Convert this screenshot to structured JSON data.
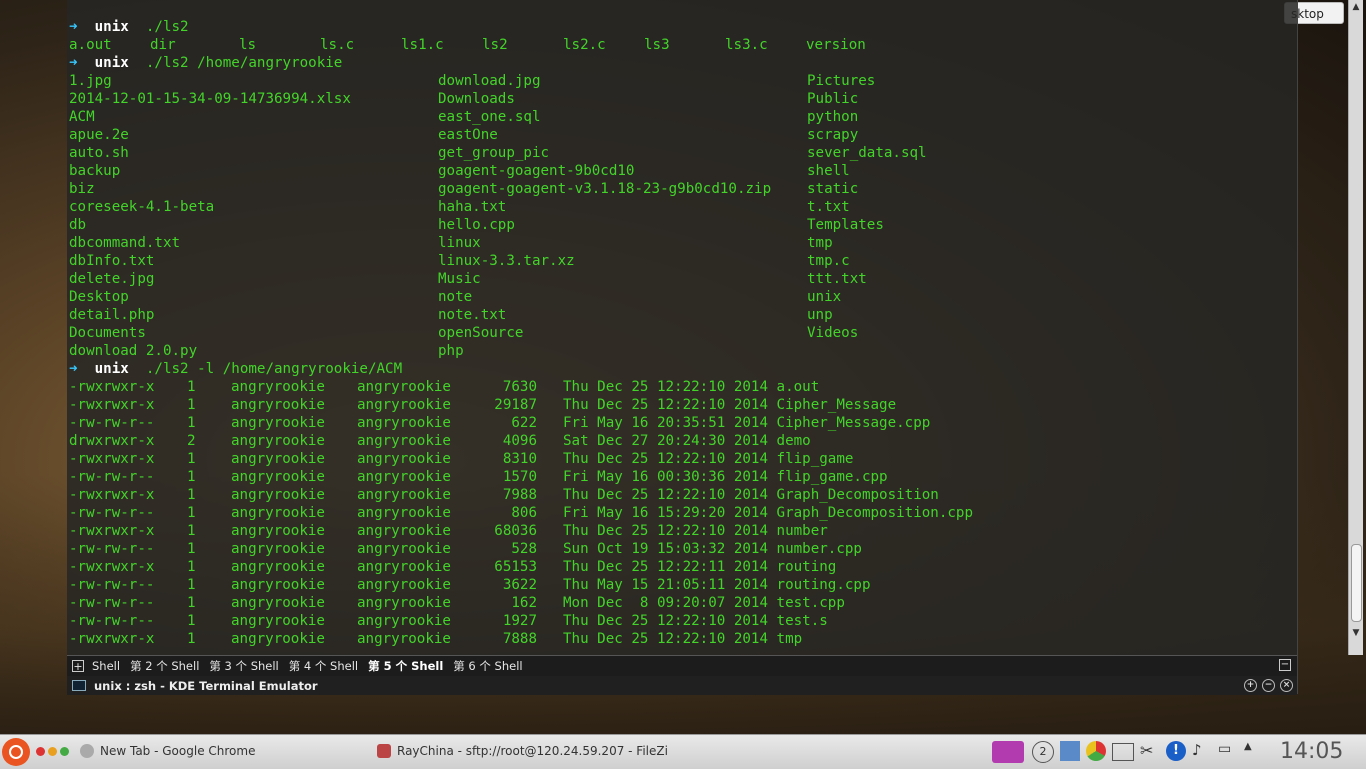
{
  "desktop": {
    "corner_label": "sktop"
  },
  "terminal": {
    "prompt_host": "unix",
    "cmd1": "./ls2",
    "cmd1_output": [
      "a.out",
      "dir",
      "ls",
      "ls.c",
      "ls1.c",
      "ls2",
      "ls2.c",
      "ls3",
      "ls3.c",
      "version"
    ],
    "cmd2": "./ls2 /home/angryrookie",
    "listing": [
      [
        "1.jpg",
        "download.jpg",
        "Pictures"
      ],
      [
        "2014-12-01-15-34-09-14736994.xlsx",
        "Downloads",
        "Public"
      ],
      [
        "ACM",
        "east_one.sql",
        "python"
      ],
      [
        "apue.2e",
        "eastOne",
        "scrapy"
      ],
      [
        "auto.sh",
        "get_group_pic",
        "sever_data.sql"
      ],
      [
        "backup",
        "goagent-goagent-9b0cd10",
        "shell"
      ],
      [
        "biz",
        "goagent-goagent-v3.1.18-23-g9b0cd10.zip",
        "static"
      ],
      [
        "coreseek-4.1-beta",
        "haha.txt",
        "t.txt"
      ],
      [
        "db",
        "hello.cpp",
        "Templates"
      ],
      [
        "dbcommand.txt",
        "linux",
        "tmp"
      ],
      [
        "dbInfo.txt",
        "linux-3.3.tar.xz",
        "tmp.c"
      ],
      [
        "delete.jpg",
        "Music",
        "ttt.txt"
      ],
      [
        "Desktop",
        "note",
        "unix"
      ],
      [
        "detail.php",
        "note.txt",
        "unp"
      ],
      [
        "Documents",
        "openSource",
        "Videos"
      ],
      [
        "download 2.0.py",
        "php",
        ""
      ]
    ],
    "cmd3": "./ls2 -l /home/angryrookie/ACM",
    "long_listing": [
      [
        "-rwxrwxr-x",
        "1",
        "angryrookie",
        "angryrookie",
        "7630",
        "Thu Dec 25 12:22:10 2014",
        "a.out"
      ],
      [
        "-rwxrwxr-x",
        "1",
        "angryrookie",
        "angryrookie",
        "29187",
        "Thu Dec 25 12:22:10 2014",
        "Cipher_Message"
      ],
      [
        "-rw-rw-r--",
        "1",
        "angryrookie",
        "angryrookie",
        "622",
        "Fri May 16 20:35:51 2014",
        "Cipher_Message.cpp"
      ],
      [
        "drwxrwxr-x",
        "2",
        "angryrookie",
        "angryrookie",
        "4096",
        "Sat Dec 27 20:24:30 2014",
        "demo"
      ],
      [
        "-rwxrwxr-x",
        "1",
        "angryrookie",
        "angryrookie",
        "8310",
        "Thu Dec 25 12:22:10 2014",
        "flip_game"
      ],
      [
        "-rw-rw-r--",
        "1",
        "angryrookie",
        "angryrookie",
        "1570",
        "Fri May 16 00:30:36 2014",
        "flip_game.cpp"
      ],
      [
        "-rwxrwxr-x",
        "1",
        "angryrookie",
        "angryrookie",
        "7988",
        "Thu Dec 25 12:22:10 2014",
        "Graph_Decomposition"
      ],
      [
        "-rw-rw-r--",
        "1",
        "angryrookie",
        "angryrookie",
        "806",
        "Fri May 16 15:29:20 2014",
        "Graph_Decomposition.cpp"
      ],
      [
        "-rwxrwxr-x",
        "1",
        "angryrookie",
        "angryrookie",
        "68036",
        "Thu Dec 25 12:22:10 2014",
        "number"
      ],
      [
        "-rw-rw-r--",
        "1",
        "angryrookie",
        "angryrookie",
        "528",
        "Sun Oct 19 15:03:32 2014",
        "number.cpp"
      ],
      [
        "-rwxrwxr-x",
        "1",
        "angryrookie",
        "angryrookie",
        "65153",
        "Thu Dec 25 12:22:11 2014",
        "routing"
      ],
      [
        "-rw-rw-r--",
        "1",
        "angryrookie",
        "angryrookie",
        "3622",
        "Thu May 15 21:05:11 2014",
        "routing.cpp"
      ],
      [
        "-rw-rw-r--",
        "1",
        "angryrookie",
        "angryrookie",
        "162",
        "Mon Dec  8 09:20:07 2014",
        "test.cpp"
      ],
      [
        "-rw-rw-r--",
        "1",
        "angryrookie",
        "angryrookie",
        "1927",
        "Thu Dec 25 12:22:10 2014",
        "test.s"
      ],
      [
        "-rwxrwxr-x",
        "1",
        "angryrookie",
        "angryrookie",
        "7888",
        "Thu Dec 25 12:22:10 2014",
        "tmp"
      ]
    ]
  },
  "tabs": [
    {
      "label": "Shell",
      "active": false
    },
    {
      "label": "第 2 个 Shell",
      "active": false
    },
    {
      "label": "第 3 个 Shell",
      "active": false
    },
    {
      "label": "第 4 个 Shell",
      "active": false
    },
    {
      "label": "第 5 个 Shell",
      "active": true
    },
    {
      "label": "第 6 个 Shell",
      "active": false
    }
  ],
  "window": {
    "title": "unix : zsh - KDE Terminal Emulator"
  },
  "taskbar": {
    "tasks": [
      "New Tab - Google Chrome",
      "RayChina - sftp://root@120.24.59.207 - FileZi"
    ],
    "clock": "14:05",
    "colors": {
      "ubuntu": "#e95420"
    }
  }
}
